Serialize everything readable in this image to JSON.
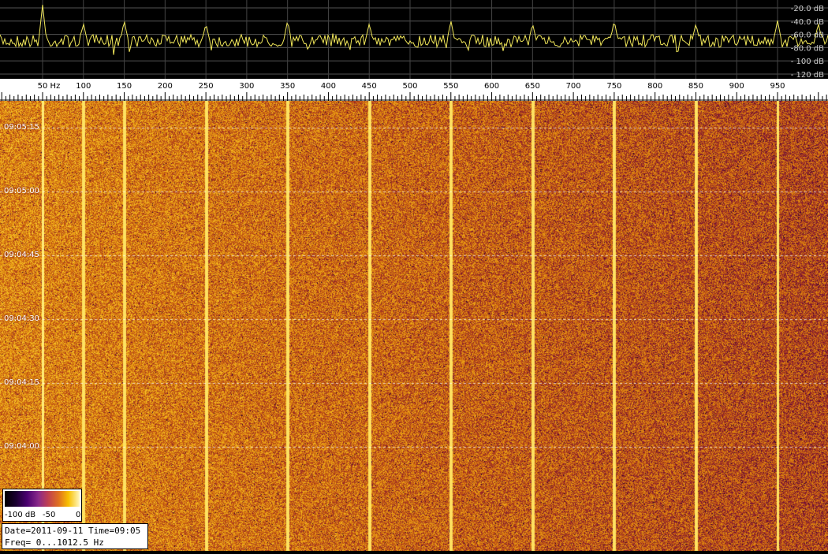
{
  "spectrum": {
    "db_labels": [
      "-20.0 dB",
      "-40.0 dB",
      "-60.0 dB",
      "-80.0 dB",
      "- 100 dB",
      "- 120 dB"
    ],
    "db_values": [
      -20,
      -40,
      -60,
      -80,
      -100,
      -120
    ],
    "trace_color": "#f2e85a",
    "peaks_hz": [
      50,
      100,
      150,
      250,
      350,
      450,
      550,
      650,
      750,
      850,
      950,
      1000
    ]
  },
  "ruler": {
    "labels": [
      "50 Hz",
      "100",
      "150",
      "200",
      "250",
      "300",
      "350",
      "400",
      "450",
      "500",
      "550",
      "600",
      "650",
      "700",
      "750",
      "800",
      "850",
      "900",
      "950"
    ],
    "values_hz": [
      50,
      100,
      150,
      200,
      250,
      300,
      350,
      400,
      450,
      500,
      550,
      600,
      650,
      700,
      750,
      800,
      850,
      900,
      950
    ],
    "max_hz": 1012.5
  },
  "waterfall": {
    "time_labels": [
      "09:05:15",
      "09:05:00",
      "09:04:45",
      "09:04:30",
      "09:04:15",
      "09:04:00"
    ],
    "bright_lines_hz": [
      50,
      100,
      150,
      250,
      350,
      450,
      550,
      650,
      750,
      850,
      950
    ]
  },
  "colorbar": {
    "min_label": "-100 dB",
    "mid_label": "-50",
    "max_label": "0"
  },
  "info": {
    "line1": "Date=2011-09-11 Time=09:05",
    "line2": "Freq= 0...1012.5 Hz"
  }
}
